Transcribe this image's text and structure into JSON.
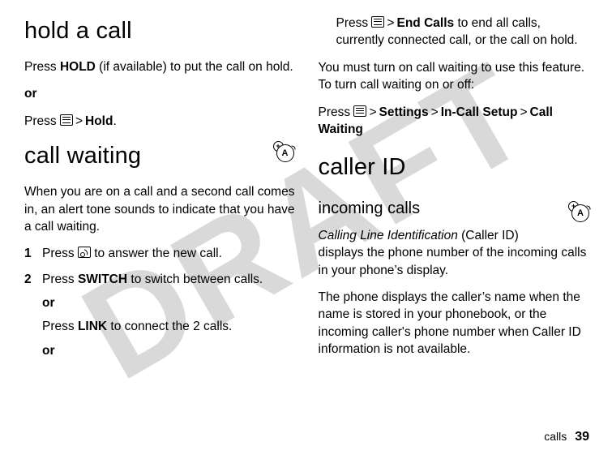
{
  "watermark": "DRAFT",
  "left": {
    "h_hold": "hold a call",
    "hold_p1_a": "Press ",
    "hold_p1_key": "HOLD",
    "hold_p1_b": " (if available) to put the call on hold.",
    "or1": "or",
    "hold_p2_a": "Press ",
    "hold_p2_gt": ">",
    "hold_p2_key": "Hold",
    "hold_p2_end": ".",
    "h_wait": "call waiting",
    "wait_intro": "When you are on a call and a second call comes in, an alert tone sounds to indicate that you have a call waiting.",
    "step1": {
      "n": "1",
      "text_a": "Press ",
      "text_b": " to answer the new call."
    },
    "step2": {
      "n": "2",
      "l1_a": "Press ",
      "l1_key": "SWITCH",
      "l1_b": " to switch between calls.",
      "or_a": "or",
      "l2_a": "Press ",
      "l2_key": "LINK",
      "l2_b": " to connect the 2 calls.",
      "or_b": "or"
    }
  },
  "right": {
    "top_a": "Press ",
    "top_gt": ">",
    "top_key": "End Calls",
    "top_b": " to end all calls, currently connected call, or the call on hold.",
    "must": "You must turn on call waiting to use this feature. To turn call waiting on or off:",
    "path_a": "Press ",
    "path_gt": ">",
    "path_k1": "Settings",
    "path_k2": "In-Call Setup",
    "path_k3": "Call Waiting",
    "h_cid": "caller ID",
    "h_inc": "incoming calls",
    "inc_a_i": "Calling Line Identification",
    "inc_a_rest": " (Caller ID) displays the phone number of the incoming calls in your phone’s display.",
    "inc_b": "The phone displays the caller’s name when the name is stored in your phonebook, or the incoming caller's phone number when Caller ID information is not available."
  },
  "footer": {
    "section": "calls",
    "page": "39"
  },
  "icons": {
    "feature_letter": "A",
    "feature_plus": "+"
  }
}
